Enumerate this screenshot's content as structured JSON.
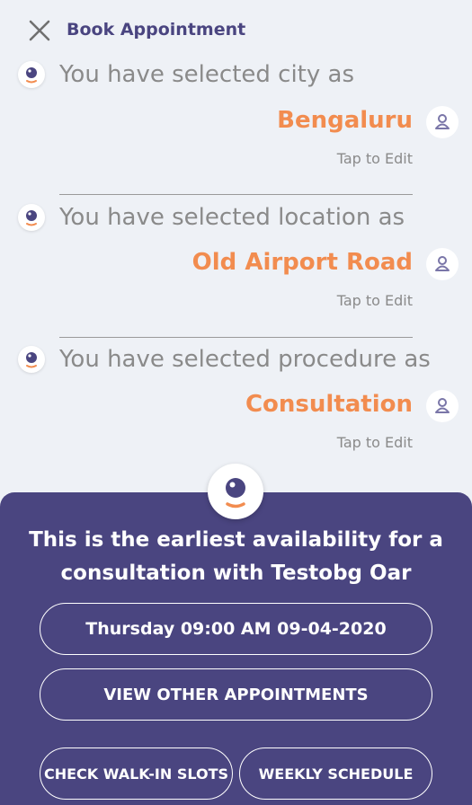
{
  "header": {
    "title": "Book Appointment",
    "close_icon": "close-icon"
  },
  "conversation": [
    {
      "bot_message": "You have selected city  as",
      "answer": "Bengaluru",
      "edit_label": "Tap to Edit"
    },
    {
      "bot_message": "You have selected location as",
      "answer": "Old Airport Road",
      "edit_label": "Tap to Edit"
    },
    {
      "bot_message": "You have selected procedure as",
      "answer": "Consultation",
      "edit_label": "Tap to Edit"
    }
  ],
  "availability": {
    "message_line1": "This is the earliest availability for a",
    "message_line2": "consultation with Testobg Oar",
    "slot_label": "Thursday 09:00 AM  09-04-2020",
    "view_other_label": "VIEW OTHER APPOINTMENTS",
    "walkin_label": "CHECK WALK-IN SLOTS",
    "weekly_label": "WEEKLY SCHEDULE"
  },
  "colors": {
    "background": "#eef1f6",
    "brand_purple": "#4a4580",
    "accent_orange": "#f28c4f",
    "muted_text": "#8a8a8a"
  }
}
